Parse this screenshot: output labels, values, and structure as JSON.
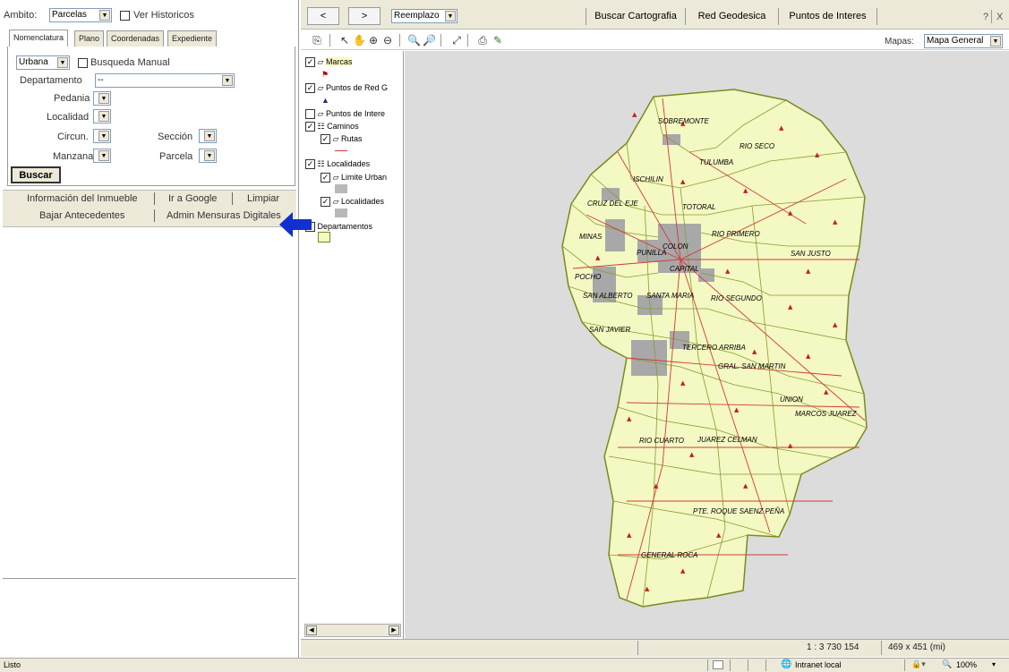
{
  "left_panel": {
    "ambito_label": "Ambito:",
    "ambito_value": "Parcelas",
    "ver_historicos": "Ver Historicos",
    "tabs": [
      "Nomenclatura",
      "Plano",
      "Coordenadas",
      "Expediente"
    ],
    "tipo_value": "Urbana",
    "busqueda_manual": "Busqueda Manual",
    "departamento_label": "Departamento",
    "departamento_value": "--",
    "pedania_label": "Pedania",
    "localidad_label": "Localidad",
    "circun_label": "Circun.",
    "seccion_label": "Sección",
    "manzana_label": "Manzana",
    "parcela_label": "Parcela",
    "buscar_button": "Buscar",
    "links": {
      "info_inmueble": "Información del Inmueble",
      "ir_google": "Ir a Google",
      "limpiar": "Limpiar",
      "bajar_antecedentes": "Bajar Antecedentes",
      "admin_mensuras": "Admin Mensuras Digitales"
    }
  },
  "toolbar": {
    "prev": "<",
    "next": ">",
    "mode_value": "Reemplazo",
    "tabs": [
      "Buscar Cartografia",
      "Red Geodesica",
      "Puntos de Interes"
    ],
    "help": "?",
    "close": "X",
    "mapas_label": "Mapas:",
    "mapas_value": "Mapa General"
  },
  "legend": {
    "marcas": "Marcas",
    "puntos_red": "Puntos de Red G",
    "puntos_interes": "Puntos de Intere",
    "caminos": "Caminos",
    "rutas": "Rutas",
    "localidades": "Localidades",
    "limite_urbano": "Limite Urban",
    "localidades_sub": "Localidades",
    "departamentos": "Departamentos"
  },
  "map_labels": {
    "sobremonte": "SOBREMONTE",
    "rio_seco": "RIO SECO",
    "tulumba": "TULUMBA",
    "ischilin": "ISCHILIN",
    "cruz_del_eje": "CRUZ DEL EJE",
    "totoral": "TOTORAL",
    "minas": "MINAS",
    "colon": "COLON",
    "rio_primero": "RIO PRIMERO",
    "punilla": "PUNILLA",
    "san_justo": "SAN JUSTO",
    "capital": "CAPITAL",
    "pocho": "POCHO",
    "san_alberto": "SAN ALBERTO",
    "santa_maria": "SANTA MARIA",
    "rio_segundo": "RIO SEGUNDO",
    "san_javier": "SAN JAVIER",
    "tercero_arriba": "TERCERO ARRIBA",
    "gral_san_martin": "GRAL. SAN MARTIN",
    "union": "UNION",
    "marcos_juarez": "MARCOS JUAREZ",
    "rio_cuarto": "RIO CUARTO",
    "juarez_celman": "JUAREZ CELMAN",
    "roque_saenz_pena": "PTE. ROQUE SAENZ PEÑA",
    "general_roca": "GENERAL ROCA"
  },
  "map_status": {
    "scale": "1 : 3 730 154",
    "size": "469 x 451 (mi)"
  },
  "statusbar": {
    "left": "Listo",
    "zone": "Intranet local",
    "zoom": "100%"
  },
  "colors": {
    "map_fill": "#f4f8c2",
    "map_border": "#7a8a20",
    "urban": "#a8a8a8",
    "roads": "#d43a3a",
    "map_background": "#dcdcdc",
    "arrow": "#1030d0"
  }
}
